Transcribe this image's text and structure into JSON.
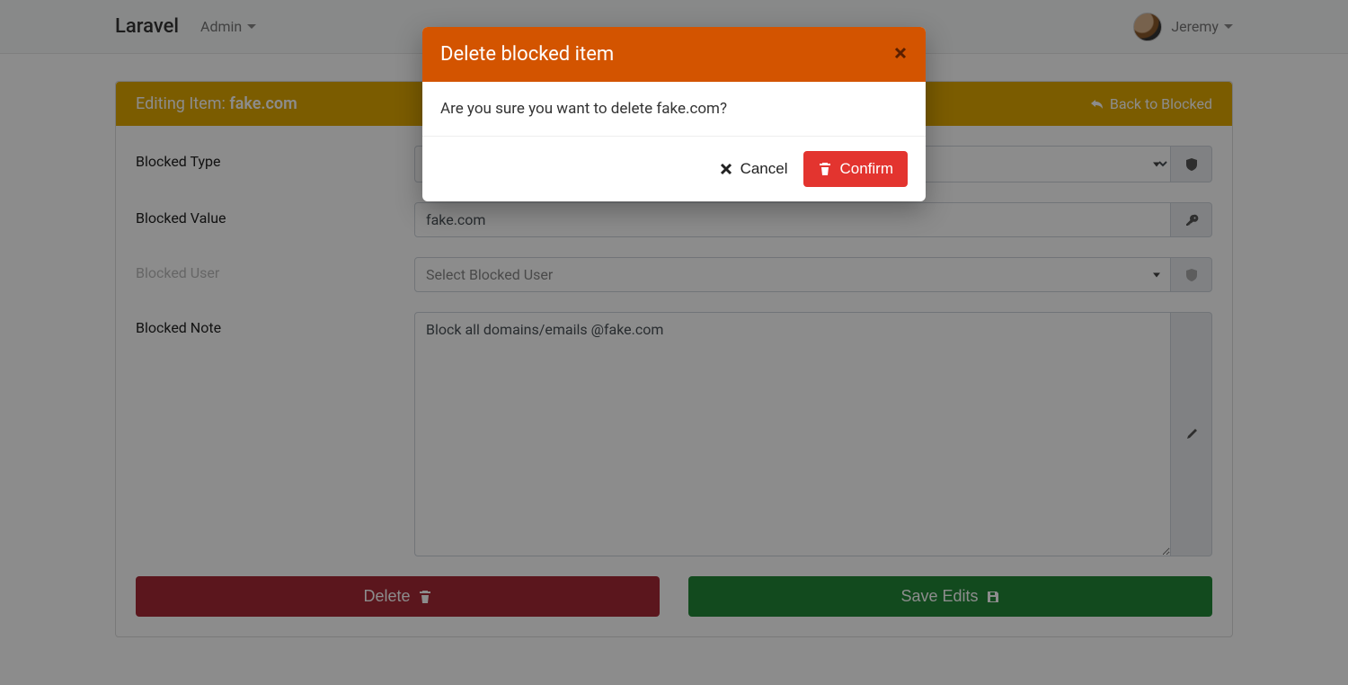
{
  "navbar": {
    "brand": "Laravel",
    "admin_label": "Admin",
    "user_name": "Jeremy"
  },
  "card": {
    "header_prefix": "Editing Item: ",
    "item_name": "fake.com",
    "back_label": "Back to Blocked"
  },
  "form": {
    "type_label": "Blocked Type",
    "type_value": "",
    "value_label": "Blocked Value",
    "value_value": "fake.com",
    "user_label": "Blocked User",
    "user_placeholder": "Select Blocked User",
    "note_label": "Blocked Note",
    "note_value": "Block all domains/emails @fake.com"
  },
  "buttons": {
    "delete": "Delete",
    "save": "Save Edits"
  },
  "modal": {
    "title": "Delete blocked item",
    "body": "Are you sure you want to delete fake.com?",
    "cancel": "Cancel",
    "confirm": "Confirm"
  }
}
